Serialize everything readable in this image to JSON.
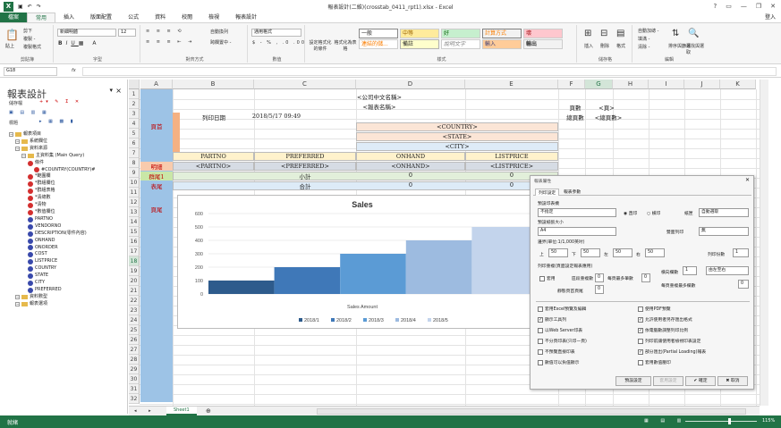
{
  "window": {
    "title": "報表設計(二維)(crosstab_0411_rpt1).xlsx - Excel",
    "user": "登入",
    "help": "?"
  },
  "tabs": [
    "檔案",
    "常用",
    "插入",
    "版面配置",
    "公式",
    "資料",
    "校閱",
    "檢視",
    "報表設計"
  ],
  "ribbon": {
    "paste": "貼上",
    "cut": "剪下",
    "copy": "複製 -",
    "format_painter": "複製格式",
    "font_name": "新細明體",
    "font_size": "12",
    "wrap": "自動換列",
    "merge": "跨欄置中 -",
    "number_format": "通用格式",
    "cond_format": "設定格式化的條件",
    "format_table": "格式化為表格",
    "styles": [
      "一般",
      "中等",
      "好",
      "計算方式",
      "壞",
      "備註",
      "說明文字",
      "輸入",
      "輸出",
      "連結的儲..."
    ],
    "insert": "插入",
    "delete": "刪除",
    "format": "格式",
    "autosum": "自動加總 -",
    "fill": "填滿 -",
    "clear": "清除 -",
    "sort_filter": "排序與篩選",
    "find_select": "尋找與選取",
    "groups": [
      "剪貼簿",
      "字型",
      "對齊方式",
      "數值",
      "樣式",
      "儲存格",
      "編輯"
    ]
  },
  "formula_bar": {
    "name_box": "G18",
    "fx": "fx",
    "value": ""
  },
  "pane": {
    "title": "報表設計",
    "close": "×",
    "pin": "▾",
    "toolbar1": "儲存檔",
    "toolbar2": "標題",
    "tree": [
      {
        "label": "報表項目",
        "icon": "folder",
        "lvl": 0
      },
      {
        "label": "系統欄位",
        "icon": "folder",
        "lvl": 1
      },
      {
        "label": "資料來源",
        "icon": "folder",
        "lvl": 1
      },
      {
        "label": "主資料集 (Main Query)",
        "icon": "folder",
        "lvl": 2
      },
      {
        "label": "條件",
        "icon": "red",
        "lvl": 3
      },
      {
        "label": "#COUNTRY(COUNTRY)#",
        "icon": "red",
        "lvl": 4
      },
      {
        "label": "*範圍欄",
        "icon": "red",
        "lvl": 3
      },
      {
        "label": "*群組欄位",
        "icon": "red",
        "lvl": 3
      },
      {
        "label": "*群組表格",
        "icon": "red",
        "lvl": 3
      },
      {
        "label": "*清總數",
        "icon": "red",
        "lvl": 3
      },
      {
        "label": "*清物",
        "icon": "red",
        "lvl": 3
      },
      {
        "label": "*數值欄位",
        "icon": "red",
        "lvl": 3
      },
      {
        "label": "PARTNO",
        "icon": "blue",
        "lvl": 3
      },
      {
        "label": "VENDORNO",
        "icon": "blue",
        "lvl": 3
      },
      {
        "label": "DESCRIPTION(零件內容)",
        "icon": "blue",
        "lvl": 3
      },
      {
        "label": "ONHAND",
        "icon": "blue",
        "lvl": 3
      },
      {
        "label": "ONORDER",
        "icon": "blue",
        "lvl": 3
      },
      {
        "label": "COST",
        "icon": "blue",
        "lvl": 3
      },
      {
        "label": "LISTPRICE",
        "icon": "blue",
        "lvl": 3
      },
      {
        "label": "COUNTRY",
        "icon": "blue",
        "lvl": 3
      },
      {
        "label": "STATE",
        "icon": "blue",
        "lvl": 3
      },
      {
        "label": "CITY",
        "icon": "blue",
        "lvl": 3
      },
      {
        "label": "PREFERRED",
        "icon": "blue",
        "lvl": 3
      },
      {
        "label": "資料數型",
        "icon": "folder",
        "lvl": 1
      },
      {
        "label": "報表選項",
        "icon": "folder",
        "lvl": 1
      }
    ]
  },
  "columns": [
    "A",
    "B",
    "C",
    "D",
    "E",
    "F",
    "G",
    "H",
    "I",
    "J",
    "K"
  ],
  "rows": [
    "1",
    "2",
    "3",
    "4",
    "5",
    "6",
    "7",
    "8",
    "9",
    "10",
    "11",
    "12",
    "13",
    "14",
    "15",
    "16",
    "17",
    "18",
    "19",
    "20",
    "21",
    "22",
    "23",
    "24",
    "25",
    "26",
    "27",
    "28",
    "29",
    "30",
    "31",
    "32"
  ],
  "cells": {
    "company": "<公司中文名稱>",
    "report_name": "<報表名稱>",
    "print_date_label": "列印日期",
    "print_date": "2018/5/17 09:49",
    "page_label": "頁數",
    "page_value": "<頁>",
    "total_pages_label": "總頁數",
    "total_pages_value": "<總頁數>",
    "header": "頁首",
    "detail": "明細",
    "group": "群尾1",
    "footer": "表尾",
    "page_footer": "頁尾",
    "country": "<COUNTRY>",
    "state": "<STATE>",
    "city": "<CITY>",
    "h_partno": "PARTNO",
    "h_preferred": "PREFERRED",
    "h_onhand": "ONHAND",
    "h_listprice": "LISTPRICE",
    "d_partno": "<PARTNO>",
    "d_preferred": "<PREFERRED>",
    "d_onhand": "<ONHAND>",
    "d_listprice": "<LISTPRICE>",
    "subtotal": "小計",
    "total": "合計",
    "zero": "0"
  },
  "chart_data": {
    "type": "bar",
    "title": "Sales",
    "xlabel": "Sales Amount",
    "categories": [
      "2018/1",
      "2018/2",
      "2018/3",
      "2018/4",
      "2018/5"
    ],
    "values": [
      100,
      200,
      300,
      400,
      500
    ],
    "ylim": [
      0,
      600
    ],
    "yticks": [
      "600",
      "500",
      "400",
      "300",
      "200",
      "100",
      "0"
    ],
    "colors": [
      "#2e5b8c",
      "#3f78b8",
      "#5b9bd5",
      "#9dbbe0",
      "#c3d4ec"
    ],
    "legend_position": "bottom"
  },
  "dialog": {
    "title": "報表屬性",
    "tabs": [
      "列印設定",
      "報表參數"
    ],
    "print_target": "預設印表機",
    "printer": "不指定",
    "paper_label": "預設紙張大小",
    "paper": "A4",
    "portrait": "直印",
    "landscape": "橫印",
    "source_label": "紙匣",
    "source": "自動選取",
    "duplex_label": "雙面列印",
    "duplex": "無",
    "margins_label": "邊界(單位:1/1,000英吋)",
    "top_label": "上",
    "top": "50",
    "bottom_label": "下",
    "bottom": "50",
    "left_label": "左",
    "left": "50",
    "right_label": "右",
    "right": "50",
    "copies_label": "列印份數",
    "copies": "1",
    "repeat_label": "列印重複(頁面設定報表應用)",
    "check_repeat": "套用",
    "rows_label": "區段重複數",
    "rows": "0",
    "cols_label": "每頁最多筆數",
    "cols": "0",
    "static_label": "靜態頁首頁尾",
    "static": "0",
    "dir_label": "橫向欄數",
    "dir": "1",
    "order_label": "由左至右",
    "pages_label": "每頁重複最多欄數",
    "pages": "0",
    "options": [
      {
        "label": "套用Excel預覽及編輯",
        "checked": false
      },
      {
        "label": "使用PDF預覽",
        "checked": false
      },
      {
        "label": "顯示工具列",
        "checked": true
      },
      {
        "label": "允許使用者另存匯出格式",
        "checked": true
      },
      {
        "label": "以Web Server印表",
        "checked": false
      },
      {
        "label": "依電腦數調整列印比例",
        "checked": true
      },
      {
        "label": "不分頁印表(只印一頁)",
        "checked": false
      },
      {
        "label": "列印前讓使用者檢視印表設定",
        "checked": false
      },
      {
        "label": "不預覽直接印表",
        "checked": false
      },
      {
        "label": "部分匯出(Partial Loading)報表",
        "checked": true
      },
      {
        "label": "數值可以負值顯示",
        "checked": false
      },
      {
        "label": "套用數值壓印",
        "checked": false
      }
    ],
    "btn_default": "預設設定",
    "btn_apply": "套用設定",
    "btn_ok": "確定",
    "btn_cancel": "取消"
  },
  "sheet_tab": "Sheet1",
  "status": {
    "ready": "就緒",
    "zoom": "115%"
  }
}
